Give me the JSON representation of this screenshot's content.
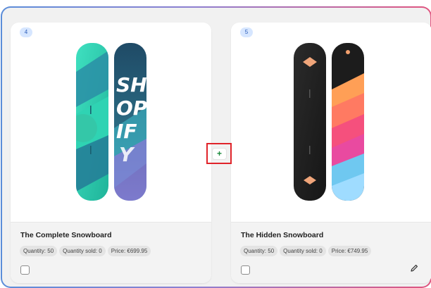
{
  "products": [
    {
      "position": "4",
      "title": "The Complete Snowboard",
      "quantity": "Quantity: 50",
      "sold": "Quantity sold: 0",
      "price": "Price: €699.95",
      "board_text": [
        "SH",
        "OP",
        "IF",
        "Y"
      ]
    },
    {
      "position": "5",
      "title": "The Hidden Snowboard",
      "quantity": "Quantity: 50",
      "sold": "Quantity sold: 0",
      "price": "Price: €749.95"
    }
  ],
  "add_button": {
    "label": "+",
    "icon": "plus-icon",
    "color": "#1a8a3c"
  },
  "colors": {
    "highlight": "#e0242a",
    "badge_bg": "#d6e6ff",
    "badge_text": "#2b5cb8"
  }
}
